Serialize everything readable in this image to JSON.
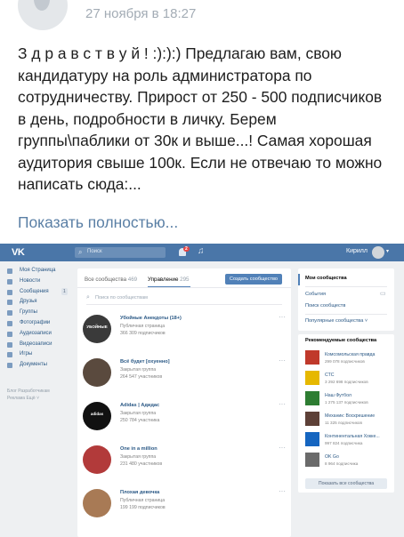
{
  "post": {
    "date": "27 ноября в 18:27",
    "text": "З д р а в с т в у й ! :):):)  Предлагаю вам, свою кандидатуру на роль администратора по сотрудничеству. Прирост от 250 - 500 подписчиков в день, подробности в личку. Берем группы\\паблики от 30к и выше...! Самая хорошая аудитория свыше 100к. Если не отвечаю то можно написать сюда:...",
    "show_more": "Показать полностью..."
  },
  "vk": {
    "logo": "VK",
    "search_placeholder": "Поиск",
    "notifications_badge": "2",
    "user_name": "Кирилл",
    "nav": [
      {
        "label": "Моя Страница",
        "icon": "home-icon"
      },
      {
        "label": "Новости",
        "icon": "news-icon"
      },
      {
        "label": "Сообщения",
        "icon": "messages-icon",
        "badge": "1"
      },
      {
        "label": "Друзья",
        "icon": "friends-icon"
      },
      {
        "label": "Группы",
        "icon": "groups-icon"
      },
      {
        "label": "Фотографии",
        "icon": "photos-icon"
      },
      {
        "label": "Аудиозаписи",
        "icon": "audio-icon"
      },
      {
        "label": "Видеозаписи",
        "icon": "video-icon"
      },
      {
        "label": "Игры",
        "icon": "games-icon"
      },
      {
        "label": "Документы",
        "icon": "documents-icon"
      }
    ],
    "footer_line1": "Блог  Разработчикам",
    "footer_line2": "Реклама  Ещё ˅",
    "tabs": {
      "all_label": "Все сообщества",
      "all_count": "469",
      "manage_label": "Управление",
      "manage_count": "295"
    },
    "create_button": "Создать сообщество",
    "group_search_placeholder": "Поиск по сообществам",
    "groups": [
      {
        "name": "Убойные Анекдоты (18+)",
        "type": "Публичная страница",
        "members": "366 309 подписчиков",
        "thumb_text": "УБОЙНЫЕ",
        "color": "#3a3a3a"
      },
      {
        "name": "Всё будет [охуенно]",
        "type": "Закрытая группа",
        "members": "264 547 участников",
        "thumb_text": "",
        "color": "#5a4a3e"
      },
      {
        "name": "Adidas | Адидас",
        "type": "Закрытая группа",
        "members": "250 784 участника",
        "thumb_text": "adidas",
        "color": "#111111"
      },
      {
        "name": "One in a million",
        "type": "Закрытая группа",
        "members": "231 480 участников",
        "thumb_text": "",
        "color": "#b23a3a"
      },
      {
        "name": "Плохая девочка",
        "type": "Публичная страница",
        "members": "199 199 подписчиков",
        "thumb_text": "",
        "color": "#a87a55"
      }
    ],
    "right_menu": {
      "selected": "Мои сообщества",
      "events": "События",
      "search": "Поиск сообществ",
      "popular": "Популярные сообщества ˅"
    },
    "recommended_title": "Рекомендуемые сообщества",
    "recommended": [
      {
        "name": "Комсомольская правда",
        "meta": "299 078 подписчиков",
        "color": "#c0392b"
      },
      {
        "name": "СТС",
        "meta": "3 292 698 подписчиков",
        "color": "#e6b800"
      },
      {
        "name": "Наш Футбол",
        "meta": "1 275 137 подписчиков",
        "color": "#2e7d32"
      },
      {
        "name": "Механик: Воскрешение",
        "meta": "11 325 подписчиков",
        "color": "#5d4037"
      },
      {
        "name": "Континентальная Хокке...",
        "meta": "997 824 подписчика",
        "color": "#1565c0"
      },
      {
        "name": "OK Go",
        "meta": "8 964 подписчика",
        "color": "#6a6a6a"
      }
    ],
    "show_all_button": "Показать все сообщества"
  }
}
